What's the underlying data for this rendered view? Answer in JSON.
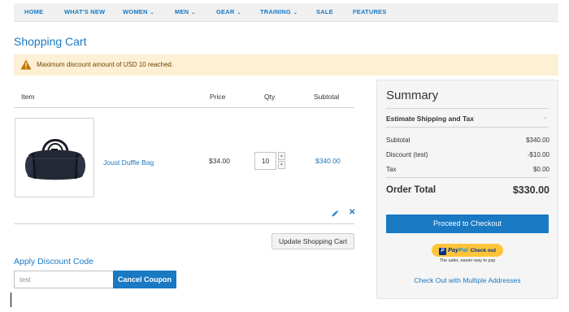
{
  "nav": {
    "items": [
      {
        "label": "HOME",
        "has_dropdown": false
      },
      {
        "label": "WHAT'S NEW",
        "has_dropdown": false
      },
      {
        "label": "WOMEN",
        "has_dropdown": true
      },
      {
        "label": "MEN",
        "has_dropdown": true
      },
      {
        "label": "GEAR",
        "has_dropdown": true
      },
      {
        "label": "TRAINING",
        "has_dropdown": true
      },
      {
        "label": "SALE",
        "has_dropdown": false
      },
      {
        "label": "FEATURES",
        "has_dropdown": false
      }
    ],
    "chevron": "⌄"
  },
  "page": {
    "title": "Shopping Cart"
  },
  "notice": {
    "icon": "warning-icon",
    "text": "Maximum discount amount of USD 10 reached."
  },
  "cart": {
    "columns": {
      "item": "Item",
      "price": "Price",
      "qty": "Qty",
      "subtotal": "Subtotal"
    },
    "items": [
      {
        "name": "Joust Duffle Bag",
        "price": "$34.00",
        "qty": "10",
        "subtotal": "$340.00",
        "image_icon": "duffle-bag-image"
      }
    ],
    "update_label": "Update Shopping Cart"
  },
  "discount": {
    "title": "Apply Discount Code",
    "code_value": "test",
    "cancel_label": "Cancel Coupon"
  },
  "summary": {
    "title": "Summary",
    "estimate_label": "Estimate Shipping and Tax",
    "estimate_chevron": "⌄",
    "rows": [
      {
        "label": "Subtotal",
        "value": "$340.00"
      },
      {
        "label": "Discount (test)",
        "value": "-$10.00"
      },
      {
        "label": "Tax",
        "value": "$0.00"
      }
    ],
    "order_total_label": "Order Total",
    "order_total_value": "$330.00",
    "checkout_label": "Proceed to Checkout",
    "paypal": {
      "logo_part1": "Pay",
      "logo_part2": "Pal",
      "checkout_text": "Check out",
      "tagline": "The safer, easier way to pay"
    },
    "multi_address_label": "Check Out with Multiple Addresses"
  },
  "colors": {
    "accent": "#1979c3",
    "notice_bg": "#fdf0d5",
    "warning": "#c07600",
    "paypal": "#ffc43a"
  }
}
